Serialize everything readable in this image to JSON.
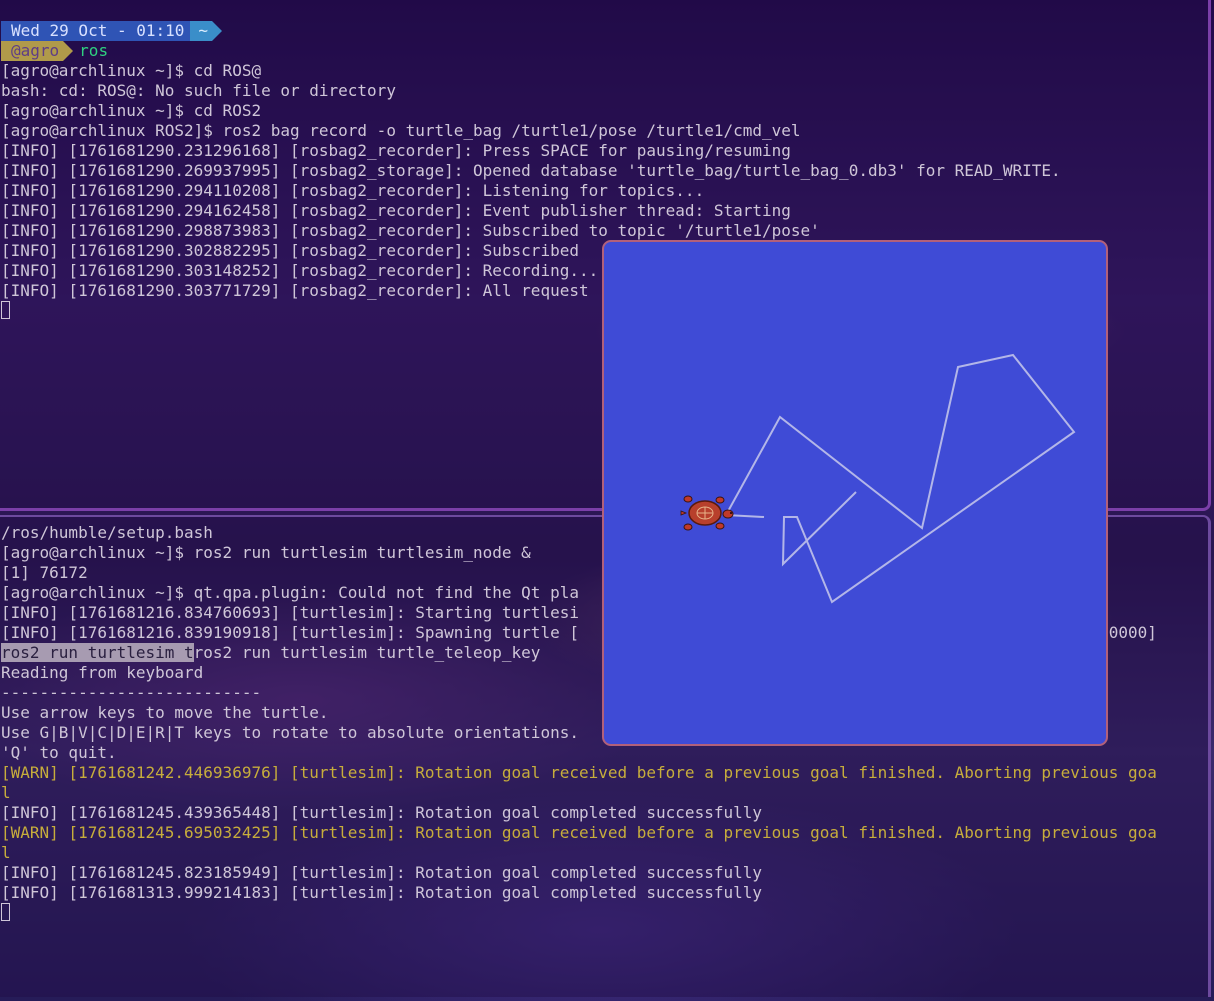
{
  "prompt_bar": {
    "date": "Wed 29 Oct - 01:10",
    "home": "~",
    "user": "@agro",
    "dir": "ros"
  },
  "top_terminal": {
    "lines": [
      "[agro@archlinux ~]$ cd ROS@",
      "bash: cd: ROS@: No such file or directory",
      "[agro@archlinux ~]$ cd ROS2",
      "[agro@archlinux ROS2]$ ros2 bag record -o turtle_bag /turtle1/pose /turtle1/cmd_vel",
      "[INFO] [1761681290.231296168] [rosbag2_recorder]: Press SPACE for pausing/resuming",
      "[INFO] [1761681290.269937995] [rosbag2_storage]: Opened database 'turtle_bag/turtle_bag_0.db3' for READ_WRITE.",
      "[INFO] [1761681290.294110208] [rosbag2_recorder]: Listening for topics...",
      "[INFO] [1761681290.294162458] [rosbag2_recorder]: Event publisher thread: Starting",
      "[INFO] [1761681290.298873983] [rosbag2_recorder]: Subscribed to topic '/turtle1/pose'",
      "[INFO] [1761681290.302882295] [rosbag2_recorder]: Subscribed",
      "[INFO] [1761681290.303148252] [rosbag2_recorder]: Recording...",
      "[INFO] [1761681290.303771729] [rosbag2_recorder]: All request"
    ]
  },
  "bottom_terminal": {
    "lines_before_selection": [
      "/ros/humble/setup.bash",
      "[agro@archlinux ~]$ ros2 run turtlesim turtlesim_node &",
      "[1] 76172",
      "[agro@archlinux ~]$ qt.qpa.plugin: Could not find the Qt pla",
      "[INFO] [1761681216.834760693] [turtlesim]: Starting turtlesi",
      "[INFO] [1761681216.839190918] [turtlesim]: Spawning turtle [                                                      00000]"
    ],
    "selected_text": "ros2 run turtlesim t",
    "selection_rest": "ros2 run turtlesim turtle_teleop_key",
    "lines_after_selection": [
      "Reading from keyboard",
      "---------------------------",
      "Use arrow keys to move the turtle.",
      "Use G|B|V|C|D|E|R|T keys to rotate to absolute orientations.",
      "'Q' to quit."
    ],
    "log_lines": [
      {
        "level": "warn",
        "text": "[WARN] [1761681242.446936976] [turtlesim]: Rotation goal received before a previous goal finished. Aborting previous goa"
      },
      {
        "level": "warn",
        "text": "l"
      },
      {
        "level": "info",
        "text": "[INFO] [1761681245.439365448] [turtlesim]: Rotation goal completed successfully"
      },
      {
        "level": "warn",
        "text": "[WARN] [1761681245.695032425] [turtlesim]: Rotation goal received before a previous goal finished. Aborting previous goa"
      },
      {
        "level": "warn",
        "text": "l"
      },
      {
        "level": "info",
        "text": "[INFO] [1761681245.823185949] [turtlesim]: Rotation goal completed successfully"
      },
      {
        "level": "info",
        "text": "[INFO] [1761681313.999214183] [turtlesim]: Rotation goal completed successfully"
      }
    ]
  },
  "turtlesim": {
    "background_color": "#3f4bd6",
    "trail_color": "#b3b6e8",
    "turtle_icon": "turtle-icon"
  },
  "colors": {
    "info_text": "#cfc6d8",
    "warn_text": "#c7ad3c",
    "prompt_dir": "#2fd080"
  }
}
